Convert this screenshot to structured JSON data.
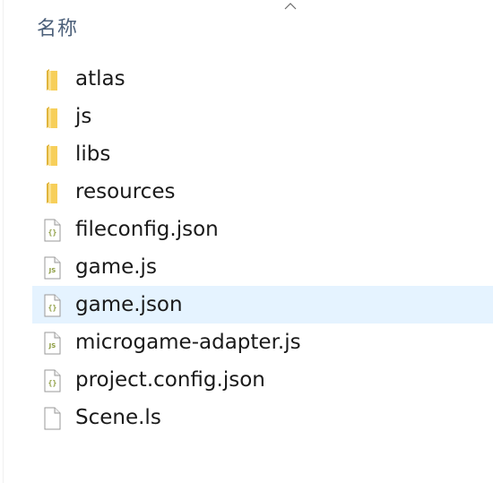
{
  "header": {
    "column_name": "名称",
    "sort_icon": "chevron-up-icon"
  },
  "files": [
    {
      "name": "atlas",
      "type": "folder",
      "icon": "folder-icon",
      "selected": false
    },
    {
      "name": "js",
      "type": "folder",
      "icon": "folder-icon",
      "selected": false
    },
    {
      "name": "libs",
      "type": "folder",
      "icon": "folder-icon",
      "selected": false
    },
    {
      "name": "resources",
      "type": "folder",
      "icon": "folder-icon",
      "selected": false
    },
    {
      "name": "fileconfig.json",
      "type": "json",
      "icon": "json-file-icon",
      "selected": false
    },
    {
      "name": "game.js",
      "type": "js",
      "icon": "js-file-icon",
      "selected": false
    },
    {
      "name": "game.json",
      "type": "json",
      "icon": "json-file-icon",
      "selected": true
    },
    {
      "name": "microgame-adapter.js",
      "type": "js",
      "icon": "js-file-icon",
      "selected": false
    },
    {
      "name": "project.config.json",
      "type": "json",
      "icon": "json-file-icon",
      "selected": false
    },
    {
      "name": "Scene.ls",
      "type": "blank",
      "icon": "blank-file-icon",
      "selected": false
    }
  ],
  "colors": {
    "selection": "#e5f3ff",
    "folder": "#f7cf5a",
    "file_badge": "#8a9a3c",
    "header_text": "#4c607a"
  }
}
